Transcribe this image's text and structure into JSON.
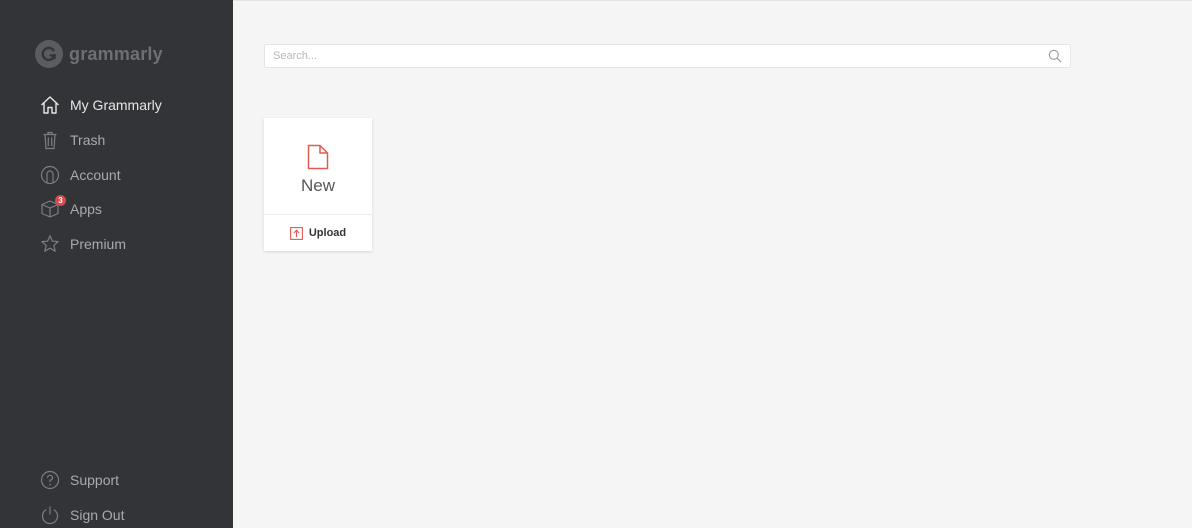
{
  "brand": {
    "name": "grammarly"
  },
  "sidebar": {
    "items": [
      {
        "label": "My Grammarly",
        "icon": "home-icon",
        "active": true
      },
      {
        "label": "Trash",
        "icon": "trash-icon"
      },
      {
        "label": "Account",
        "icon": "account-icon"
      },
      {
        "label": "Apps",
        "icon": "apps-icon",
        "badge": "3"
      },
      {
        "label": "Premium",
        "icon": "star-icon"
      }
    ],
    "bottom_items": [
      {
        "label": "Support",
        "icon": "help-icon"
      },
      {
        "label": "Sign Out",
        "icon": "power-icon"
      }
    ]
  },
  "search": {
    "placeholder": "Search...",
    "value": ""
  },
  "new_card": {
    "new_label": "New",
    "upload_label": "Upload"
  },
  "colors": {
    "sidebar_bg": "#333437",
    "accent": "#e25c52",
    "badge": "#d94a4a",
    "main_bg": "#f5f5f5"
  }
}
